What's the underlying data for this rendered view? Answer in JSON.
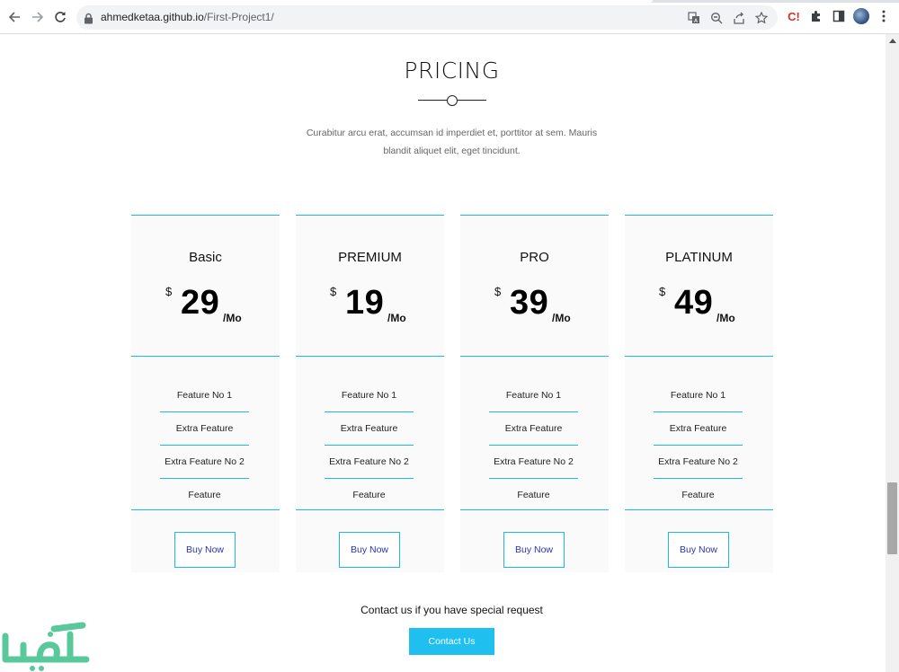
{
  "browser": {
    "url_host": "ahmedketaa.github.io",
    "url_path": "/First-Project1/",
    "extension_label": "C!",
    "icons": [
      "back-icon",
      "forward-icon",
      "reload-icon",
      "lock-icon",
      "translate-icon",
      "zoom-icon",
      "share-icon",
      "star-icon",
      "credential-extension-icon",
      "puzzle-icon",
      "sidepanel-icon",
      "avatar",
      "kebab-menu-icon"
    ]
  },
  "section": {
    "title": "PRICING",
    "intro": "Curabitur arcu erat, accumsan id imperdiet et, porttitor at sem. Mauris blandit aliquet elit, eget tincidunt."
  },
  "plans": [
    {
      "name": "Basic",
      "currency": "$",
      "amount": "29",
      "period": "/Mo",
      "features": [
        "Feature No 1",
        "Extra Feature",
        "Extra Feature No 2",
        "Feature"
      ],
      "button": "Buy Now"
    },
    {
      "name": "PREMIUM",
      "currency": "$",
      "amount": "19",
      "period": "/Mo",
      "features": [
        "Feature No 1",
        "Extra Feature",
        "Extra Feature No 2",
        "Feature"
      ],
      "button": "Buy Now"
    },
    {
      "name": "PRO",
      "currency": "$",
      "amount": "39",
      "period": "/Mo",
      "features": [
        "Feature No 1",
        "Extra Feature",
        "Extra Feature No 2",
        "Feature"
      ],
      "button": "Buy Now"
    },
    {
      "name": "PLATINUM",
      "currency": "$",
      "amount": "49",
      "period": "/Mo",
      "features": [
        "Feature No 1",
        "Extra Feature",
        "Extra Feature No 2",
        "Feature"
      ],
      "button": "Buy Now"
    }
  ],
  "contact": {
    "text": "Contact us if you have special request",
    "button": "Contact Us"
  },
  "colors": {
    "accent": "#1fb6e8",
    "contact_button": "#1fc0f0",
    "buy_text": "#2a34b8",
    "card_bg": "#fafafa",
    "watermark": "#3dbf8a"
  }
}
